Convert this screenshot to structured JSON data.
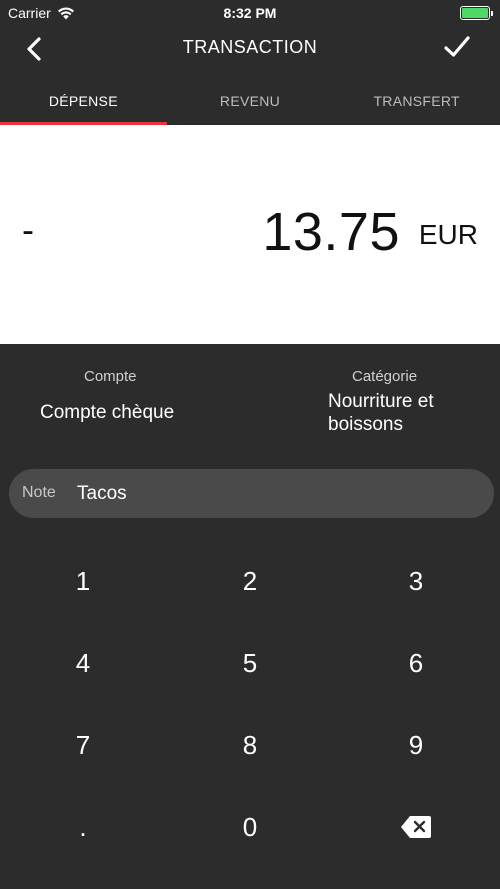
{
  "status_bar": {
    "carrier": "Carrier",
    "time": "8:32 PM",
    "wifi_icon": "wifi-icon",
    "battery_level": 1.0,
    "battery_color": "#4cd964"
  },
  "nav": {
    "title": "TRANSACTION",
    "back_icon": "chevron-left-icon",
    "confirm_icon": "checkmark-icon"
  },
  "tabs": [
    {
      "label": "DÉPENSE",
      "active": true
    },
    {
      "label": "REVENU",
      "active": false
    },
    {
      "label": "TRANSFERT",
      "active": false
    }
  ],
  "accent_color": "#e8353b",
  "amount": {
    "sign": "-",
    "value": "13.75",
    "currency": "EUR"
  },
  "account": {
    "label": "Compte",
    "value": "Compte chèque"
  },
  "category": {
    "label": "Catégorie",
    "value_line1": "Nourriture et",
    "value_line2": "boissons"
  },
  "note": {
    "label": "Note",
    "value": "Tacos"
  },
  "keypad": {
    "keys": [
      "1",
      "2",
      "3",
      "4",
      "5",
      "6",
      "7",
      "8",
      "9",
      ".",
      "0"
    ],
    "backspace_icon": "backspace-icon"
  }
}
